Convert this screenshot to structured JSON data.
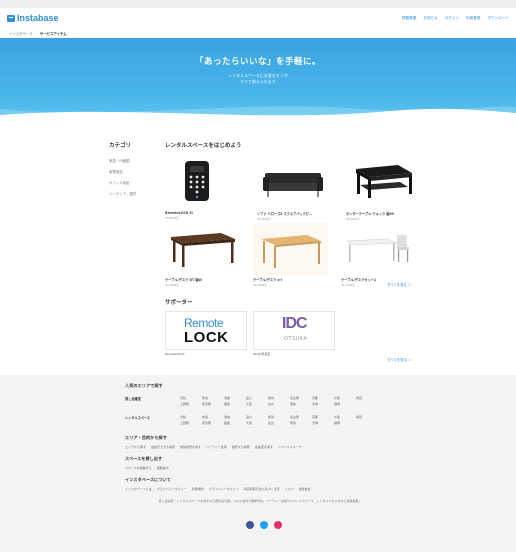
{
  "header": {
    "logo": "Instabase",
    "nav": [
      "掲載概要",
      "お知らせ",
      "ログイン",
      "利用登録",
      "ダウンロード"
    ]
  },
  "breadcrumb": {
    "home": "インスタベース",
    "current": "サービスアイテム"
  },
  "hero": {
    "title": "「あったらいいな」を手軽に。",
    "line1": "レンタルスペースに必要なモノが",
    "line2": "すべて揃えられます"
  },
  "sidebar": {
    "title": "カテゴリ",
    "items": [
      "家具・什器類",
      "家電用品",
      "オフィス用品",
      "インテリア・雑貨"
    ]
  },
  "main": {
    "title": "レンタルスペースをはじめよう",
    "products": [
      {
        "name": "RemoteLOCK 5i",
        "price": "25,800円"
      },
      {
        "name": "ソファ ベローズ2 スクエアバックピ…",
        "price": "39,800円"
      },
      {
        "name": "センターテーブル ウォック 幅90",
        "price": "26,800円"
      },
      {
        "name": "テーブル/デスク GT 幅W",
        "price": "29,800円"
      },
      {
        "name": "テーブル/デスク a-l",
        "price": "28,300円"
      },
      {
        "name": "テーブル/デスクセット1",
        "price": "31,200円"
      }
    ],
    "more_link": "すべてを見る ＞",
    "supporters_title": "サポーター",
    "supporters": [
      {
        "name": "RemoteLOCK",
        "logo_top": "Remote",
        "logo_bottom": "LOCK"
      },
      {
        "name": "IDCの家具店",
        "logo_top": "IDC",
        "logo_bottom": "OTSUKA"
      }
    ],
    "supporters_more": "すべてを見る ＞"
  },
  "footer": {
    "popular_title": "人気のエリアで探す",
    "rows": [
      {
        "label": "貸し会議室",
        "areas": [
          "渋谷",
          "新宿",
          "池袋",
          "品川",
          "横浜",
          "名古屋",
          "京都",
          "大阪",
          "梅田",
          "上野駅",
          "東京駅",
          "銀座",
          "大宮",
          "仙台",
          "博多",
          "天神",
          "福岡"
        ]
      },
      {
        "label": "レンタルスペース",
        "areas": [
          "渋谷",
          "新宿",
          "池袋",
          "品川",
          "横浜",
          "名古屋",
          "京都",
          "大阪",
          "梅田",
          "上野駅",
          "東京駅",
          "銀座",
          "大宮",
          "仙台",
          "博多",
          "天神",
          "福岡"
        ]
      }
    ],
    "search_title": "エリア・目的から探す",
    "search_links": [
      "エリアから探す",
      "会議ができる場所",
      "勉強場所を探す",
      "パーティー会場",
      "撮影する場所",
      "会議室を探す",
      "イベントスペース"
    ],
    "list_title": "スペースを貸し出す",
    "list_links": [
      "スペースを掲載する",
      "掲載案内"
    ],
    "about_title": "インスタベースについて",
    "about_links": [
      "インスタベースとは",
      "プライバシーポリシー",
      "利用規約",
      "プライバシーポリシー",
      "特定商取引法に基づく表示",
      "ヘルプ",
      "運営会社"
    ],
    "desc": "貸し会議室・レンタルスペースを探すなら国内最大級。スマホ決済で簡単予約。パーティー会場やイベントスペース、レンタルスタジオなど多数掲載。",
    "social_colors": [
      "#3b5998",
      "#1da1f2",
      "#e1306c"
    ]
  }
}
